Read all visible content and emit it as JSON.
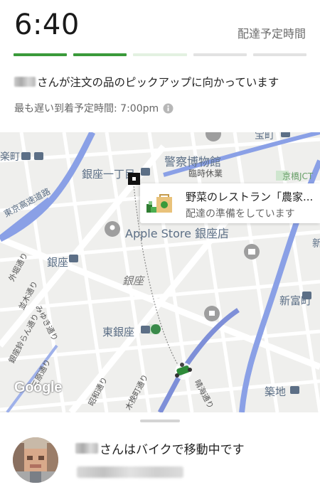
{
  "header": {
    "eta_time": "6:40",
    "eta_label": "配達予定時間",
    "progress": {
      "segments_total": 5,
      "completed": 2,
      "in_progress": 1
    },
    "status_text": "さんが注文の品のピックアップに向かっています",
    "latest_arrival": "最も遅い到着予定時間: 7:00pm",
    "info_icon": "info-icon"
  },
  "map": {
    "labels": {
      "ginza_itchome": "銀座一丁目",
      "keisatsu": "警察博物館",
      "rinji": "臨時休業",
      "kyobashi_jct": "京橋JCT",
      "shuto": "東京高速道路",
      "apple_store": "Apple Store 銀座店",
      "ginza_station": "銀座",
      "ginza_area": "銀座",
      "higashi_ginza": "東銀座",
      "shintomicho": "新富町",
      "tsukiji": "築地",
      "raku_cho": "楽町",
      "takara": "宝町",
      "shin": "新"
    },
    "streets": {
      "sotobori": "外堀通り",
      "namiki": "並木通り",
      "miyuki": "みゆき通り",
      "ginza_suzuran": "銀座鈴らん通り",
      "sanjihara": "三原通り",
      "showa": "昭和通り",
      "kobiki": "木挽町通り",
      "harumi": "晴海通り"
    },
    "popup": {
      "restaurant_name": "野菜のレストラン「農家...",
      "status": "配達の準備をしています"
    },
    "attribution": "Google"
  },
  "courier": {
    "status_text": "さんはバイクで移動中です"
  },
  "colors": {
    "progress_done": "#3a9a3a",
    "progress_partial": "#e3f1e1",
    "progress_pending": "#e2e2e2",
    "route": "#7e8fd8",
    "highway": "#8aa0e6"
  }
}
